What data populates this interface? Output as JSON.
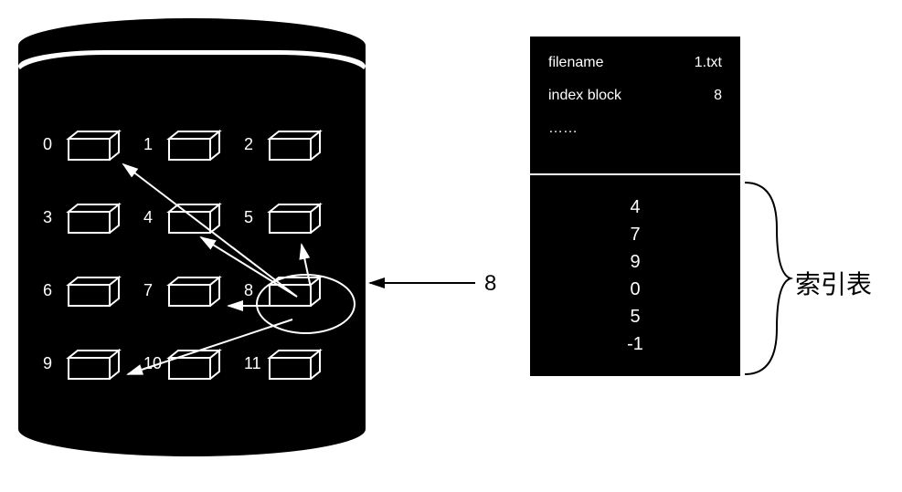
{
  "disk": {
    "blocks": [
      {
        "id": 0,
        "label": "0"
      },
      {
        "id": 1,
        "label": "1"
      },
      {
        "id": 2,
        "label": "2"
      },
      {
        "id": 3,
        "label": "3"
      },
      {
        "id": 4,
        "label": "4"
      },
      {
        "id": 5,
        "label": "5"
      },
      {
        "id": 6,
        "label": "6"
      },
      {
        "id": 7,
        "label": "7"
      },
      {
        "id": 8,
        "label": "8"
      },
      {
        "id": 9,
        "label": "9"
      },
      {
        "id": 10,
        "label": "10"
      },
      {
        "id": 11,
        "label": "11"
      }
    ],
    "highlighted_block": 8
  },
  "pointer": {
    "label": "8",
    "target_block": 8
  },
  "file_table": {
    "filename_key": "filename",
    "filename_value": "1.txt",
    "index_block_key": "index block",
    "index_block_value": "8",
    "ellipsis": "……"
  },
  "index_table": {
    "values": [
      "4",
      "7",
      "9",
      "0",
      "5",
      "-1"
    ],
    "label": "索引表"
  },
  "arrows_from_block8_to": [
    0,
    4,
    5,
    7,
    9
  ]
}
